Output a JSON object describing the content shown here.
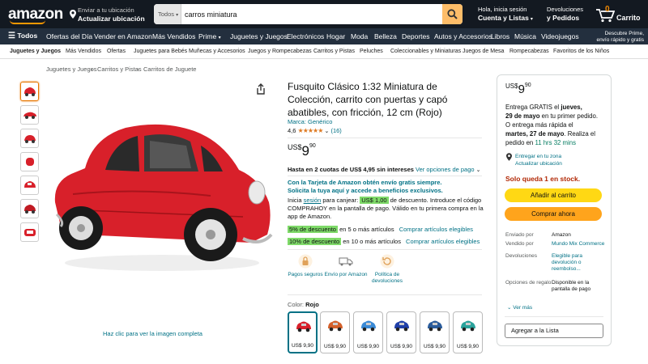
{
  "header": {
    "logo": "amazon",
    "location_line1": "Enviar a tu ubicación",
    "location_line2": "Actualizar ubicación",
    "search_category": "Todos",
    "search_value": "carros miniatura",
    "account_line1": "Hola, inicia sesión",
    "account_line2": "Cuenta y Listas",
    "returns_line1": "Devoluciones",
    "returns_line2": "y Pedidos",
    "cart_count": "0",
    "cart_label": "Carrito"
  },
  "nav": {
    "menu_label": "Todos",
    "items": [
      "Ofertas del Día",
      "Vender en Amazon",
      "Más Vendidos",
      "Prime",
      "Juguetes y Juegos",
      "Electrónicos",
      "Hogar",
      "Moda",
      "Belleza",
      "Deportes",
      "Autos y Accesorios",
      "Libros",
      "Música",
      "Videojuegos"
    ],
    "promo_line1": "Descubre Prime,",
    "promo_line2": "envío rápido y gratis"
  },
  "subnav": {
    "items": [
      "Juguetes y Juegos",
      "Más Vendidos",
      "Ofertas",
      "Juguetes para Bebés",
      "Muñecas y Accesorios",
      "Juegos y Rompecabezas",
      "Carritos y Pistas",
      "Peluches",
      "Coleccionables y Miniaturas",
      "Juegos de Mesa",
      "Rompecabezas",
      "Favoritos de los Niños"
    ]
  },
  "breadcrumb": [
    "Juguetes y Juegos",
    "Carritos y Pistas",
    "Carritos de Juguete"
  ],
  "gallery": {
    "caption": "Haz clic para ver la imagen completa",
    "thumb_count": 7
  },
  "product": {
    "title": "Fusquito Clásico 1:32 Miniatura de Colección, carrito con puertas y capó abatibles, con fricción, 12 cm (Rojo)",
    "brand_label": "Marca: Genérico",
    "rating": "4,6",
    "rating_stars": 4.6,
    "review_count": "(16)",
    "currency": "US$",
    "price_whole": "9",
    "price_fraction": "90",
    "installments": "Hasta en 2 cuotas de US$ 4,95 sin intereses",
    "payment_options": "Ver opciones de pago",
    "card_promo_line1": "Con la Tarjeta de Amazon obtén envío gratis siempre.",
    "card_promo_line2": "Solicita la tuya aquí y accede a beneficios exclusivos.",
    "coupon_pre": "Inicia",
    "coupon_link": "sesión",
    "coupon_mid": "para canjear:",
    "coupon_badge": "US$ 1,00",
    "coupon_post": "de descuento. Introduce el código",
    "coupon_line2": "COMPRAHOY en la pantalla de pago. Válido en tu primera compra en la",
    "coupon_line3": "app de Amazon.",
    "discount1_badge": "5% de descuento",
    "discount1_text": "en 5 o más artículos",
    "discount1_link": "Comprar artículos elegibles",
    "discount2_badge": "10% de descuento",
    "discount2_text": "en 10 o más artículos",
    "discount2_link": "Comprar artículos elegibles",
    "features": [
      {
        "icon": "lock-icon",
        "label": "Pagos seguros"
      },
      {
        "icon": "truck-icon",
        "label": "Envío por Amazon"
      },
      {
        "icon": "return-icon",
        "label": "Política de devoluciones"
      }
    ],
    "color_label": "Color:",
    "color_value": "Rojo",
    "swatches": [
      {
        "color": "#d8202a",
        "price": "US$ 9,90"
      },
      {
        "color": "#d4602a",
        "price": "US$ 9,90"
      },
      {
        "color": "#3a8ad6",
        "price": "US$ 9,90"
      },
      {
        "color": "#1f3fa8",
        "price": "US$ 9,90"
      },
      {
        "color": "#2a5c9c",
        "price": "US$ 9,90"
      },
      {
        "color": "#2aa39c",
        "price": "US$ 9,90"
      }
    ]
  },
  "buybox": {
    "currency": "US$",
    "price_whole": "9",
    "price_fraction": "90",
    "delivery_l1": "Entrega GRATIS el",
    "delivery_date": "jueves,",
    "delivery_l2a": "29 de mayo",
    "delivery_l2b": "en tu primer pedido.",
    "delivery_l3": "O entrega más rápida el",
    "delivery_l4a": "martes, 27 de mayo",
    "delivery_l4b": ". Realiza el",
    "delivery_l5a": "pedido en",
    "delivery_countdown": "11 hrs 32 mins",
    "zone_line1": "Entregar en tu zona",
    "zone_line2": "Actualizar ubicación",
    "stock": "Solo queda 1 en stock.",
    "add_to_cart": "Añadir al carrito",
    "buy_now": "Comprar ahora",
    "details": [
      {
        "k": "Enviado por",
        "v": "Amazon"
      },
      {
        "k": "Vendido por",
        "v": "Mundo Mix Commerce"
      },
      {
        "k": "Devoluciones",
        "v": "Elegible para devolución o reembolso..."
      },
      {
        "k": "Opciones de regalo",
        "v": "Disponible en la pantalla de pago"
      }
    ],
    "see_more": "Ver más",
    "add_to_list": "Agregar a la Lista"
  },
  "colors": {
    "accent": "#febd69",
    "link": "#007185",
    "stock_red": "#b12704",
    "cart_btn": "#ffd814",
    "buy_btn": "#ffa41c",
    "product_red": "#d8202a"
  }
}
